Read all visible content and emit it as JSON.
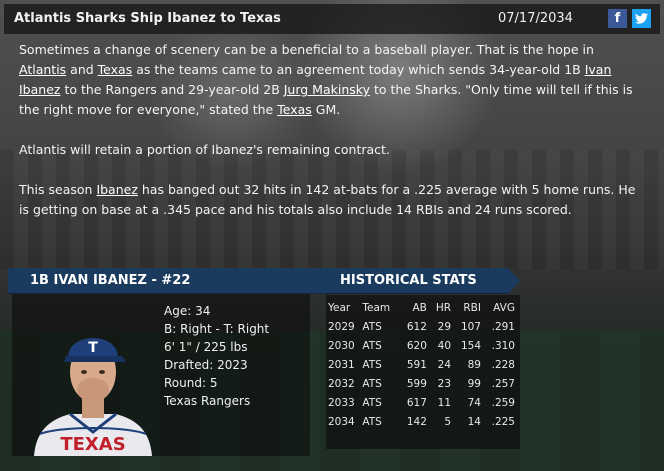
{
  "header": {
    "headline": "Atlantis Sharks Ship Ibanez to Texas",
    "date": "07/17/2034",
    "facebook_icon": "f",
    "twitter_icon": "t"
  },
  "article": {
    "p1": {
      "t1": "Sometimes a change of scenery can be a beneficial to a baseball player. That is the hope in ",
      "l1": "Atlantis",
      "t2": " and ",
      "l2": "Texas",
      "t3": " as the teams came to an agreement today which sends 34-year-old 1B ",
      "l3": "Ivan Ibanez",
      "t4": " to the Rangers and 29-year-old 2B ",
      "l4": "Jurg Makinsky",
      "t5": " to the Sharks. \"Only time will tell if this is the right move for everyone,\" stated the ",
      "l5": "Texas",
      "t6": " GM."
    },
    "p2": "Atlantis will retain a portion of Ibanez's remaining contract.",
    "p3": {
      "t1": "This season ",
      "l1": "Ibanez",
      "t2": " has banged out 32 hits in 142 at-bats for a .225 average with 5 home runs. He is getting on base at a .345 pace and his totals also include 14 RBIs and 24 runs scored."
    }
  },
  "player": {
    "banner": "1B IVAN IBANEZ - #22",
    "age": "Age: 34",
    "bats_throws": "B: Right - T: Right",
    "height_weight": "6' 1\" / 225 lbs",
    "drafted": "Drafted: 2023",
    "round": "Round: 5",
    "team": "Texas Rangers",
    "jersey_text": "TEXAS",
    "cap_letter": "T"
  },
  "stats": {
    "banner": "HISTORICAL STATS",
    "headers": [
      "Year",
      "Team",
      "AB",
      "HR",
      "RBI",
      "AVG"
    ],
    "rows": [
      [
        "2029",
        "ATS",
        "612",
        "29",
        "107",
        ".291"
      ],
      [
        "2030",
        "ATS",
        "620",
        "40",
        "154",
        ".310"
      ],
      [
        "2031",
        "ATS",
        "591",
        "24",
        "89",
        ".228"
      ],
      [
        "2032",
        "ATS",
        "599",
        "23",
        "99",
        ".257"
      ],
      [
        "2033",
        "ATS",
        "617",
        "11",
        "74",
        ".259"
      ],
      [
        "2034",
        "ATS",
        "142",
        "5",
        "14",
        ".225"
      ]
    ]
  },
  "colors": {
    "banner": "#1a3a5e",
    "facebook": "#3b5998",
    "twitter": "#1da1f2",
    "jersey_red": "#c0202a",
    "cap_blue": "#1e3f7a"
  }
}
